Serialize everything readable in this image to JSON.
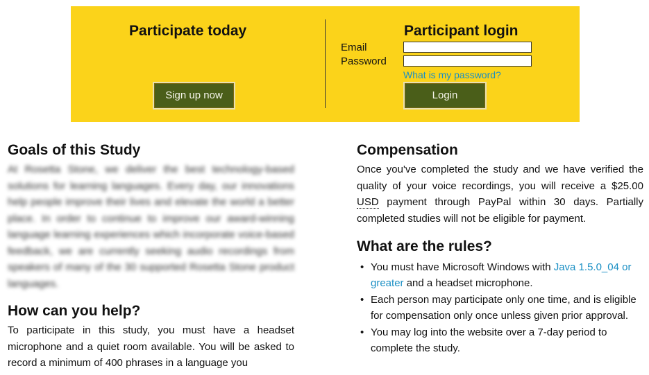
{
  "banner": {
    "left_title": "Participate today",
    "signup_label": "Sign up now",
    "right_title": "Participant login",
    "email_label": "Email",
    "password_label": "Password",
    "email_value": "",
    "password_value": "",
    "password_help_link": "What is my password?",
    "login_label": "Login",
    "background_color": "#fbd31a",
    "button_color": "#4a5e19",
    "link_color": "#1a8fc4"
  },
  "goals": {
    "heading": "Goals of this Study",
    "body": "At Rosetta Stone, we deliver the best technology-based solutions for learning languages. Every day, our innovations help people improve their lives and elevate the world a better place. In order to continue to improve our award-winning language learning experiences which incorporate voice-based feedback, we are currently seeking audio recordings from speakers of many of the 30 supported Rosetta Stone product languages."
  },
  "help": {
    "heading": "How can you help?",
    "body": "To participate in this study, you must have a headset microphone and a quiet room available. You will be asked to record a minimum of 400 phrases in a language you"
  },
  "compensation": {
    "heading": "Compensation",
    "body_before": "Once you've completed the study and we have verified the quality of your voice recordings, you will receive a $25.00 ",
    "currency": "USD",
    "body_after": " payment through PayPal within 30 days. Partially completed studies will not be eligible for payment."
  },
  "rules": {
    "heading": "What are the rules?",
    "items": [
      {
        "before": "You must have Microsoft Windows with ",
        "link": "Java 1.5.0_04 or greater",
        "after": " and a headset microphone."
      },
      {
        "text": "Each person may participate only one time, and is eligible for compensation only once unless given prior approval."
      },
      {
        "text": "You may log into the website over a 7-day period to complete the study."
      }
    ]
  }
}
